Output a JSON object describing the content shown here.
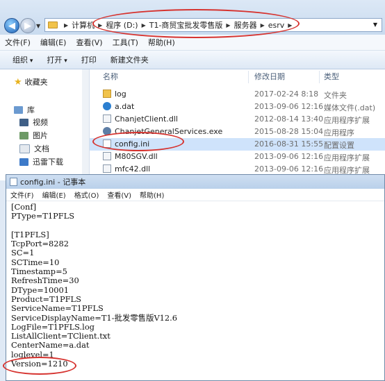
{
  "explorer": {
    "breadcrumbs": [
      "计算机",
      "程序 (D:)",
      "T1-商贸宝批发零售版",
      "服务器",
      "esrv"
    ],
    "menu": [
      "文件(F)",
      "编辑(E)",
      "查看(V)",
      "工具(T)",
      "帮助(H)"
    ],
    "toolbar": {
      "organize": "组织",
      "open": "打开",
      "print": "打印",
      "new_folder": "新建文件夹"
    },
    "nav": {
      "favorites": "收藏夹",
      "library": "库",
      "video": "视频",
      "pictures": "图片",
      "documents": "文档",
      "downloads": "迅雷下载"
    },
    "columns": {
      "name": "名称",
      "date": "修改日期",
      "type": "类型"
    },
    "files": [
      {
        "name": "log",
        "date": "2017-02-24 8:18",
        "type": "文件夹",
        "icon": "folder-icon"
      },
      {
        "name": "a.dat",
        "date": "2013-09-06 12:16",
        "type": "媒体文件(.dat)",
        "icon": "media-file-icon"
      },
      {
        "name": "ChanjetClient.dll",
        "date": "2012-08-14 13:40",
        "type": "应用程序扩展",
        "icon": "dll-file-icon"
      },
      {
        "name": "ChanjetGeneralServices.exe",
        "date": "2015-08-28 15:04",
        "type": "应用程序",
        "icon": "exe-file-icon"
      },
      {
        "name": "config.ini",
        "date": "2016-08-31 15:55",
        "type": "配置设置",
        "icon": "ini-file-icon"
      },
      {
        "name": "M80SGV.dll",
        "date": "2013-09-06 12:16",
        "type": "应用程序扩展",
        "icon": "dll-file-icon"
      },
      {
        "name": "mfc42.dll",
        "date": "2013-09-06 12:16",
        "type": "应用程序扩展",
        "icon": "dll-file-icon"
      }
    ]
  },
  "notepad": {
    "title": "config.ini - 记事本",
    "menu": [
      "文件(F)",
      "编辑(E)",
      "格式(O)",
      "查看(V)",
      "帮助(H)"
    ],
    "lines": [
      "[Conf]",
      "PType=T1PFLS",
      "",
      "[T1PFLS]",
      "TcpPort=8282",
      "SC=1",
      "SCTime=10",
      "Timestamp=5",
      "RefreshTime=30",
      "DType=10001",
      "Product=T1PFLS",
      "ServiceName=T1PFLS",
      "ServiceDisplayName=T1-批发零售版V12.6",
      "LogFile=T1PFLS.log",
      "ListAllClient=TClient.txt",
      "CenterName=a.dat",
      "loglevel=1",
      "Version=1210"
    ]
  },
  "colors": {
    "annotation": "#d6332f",
    "titlebar": "#c4d8ee",
    "selection": "#cfe3fb"
  }
}
